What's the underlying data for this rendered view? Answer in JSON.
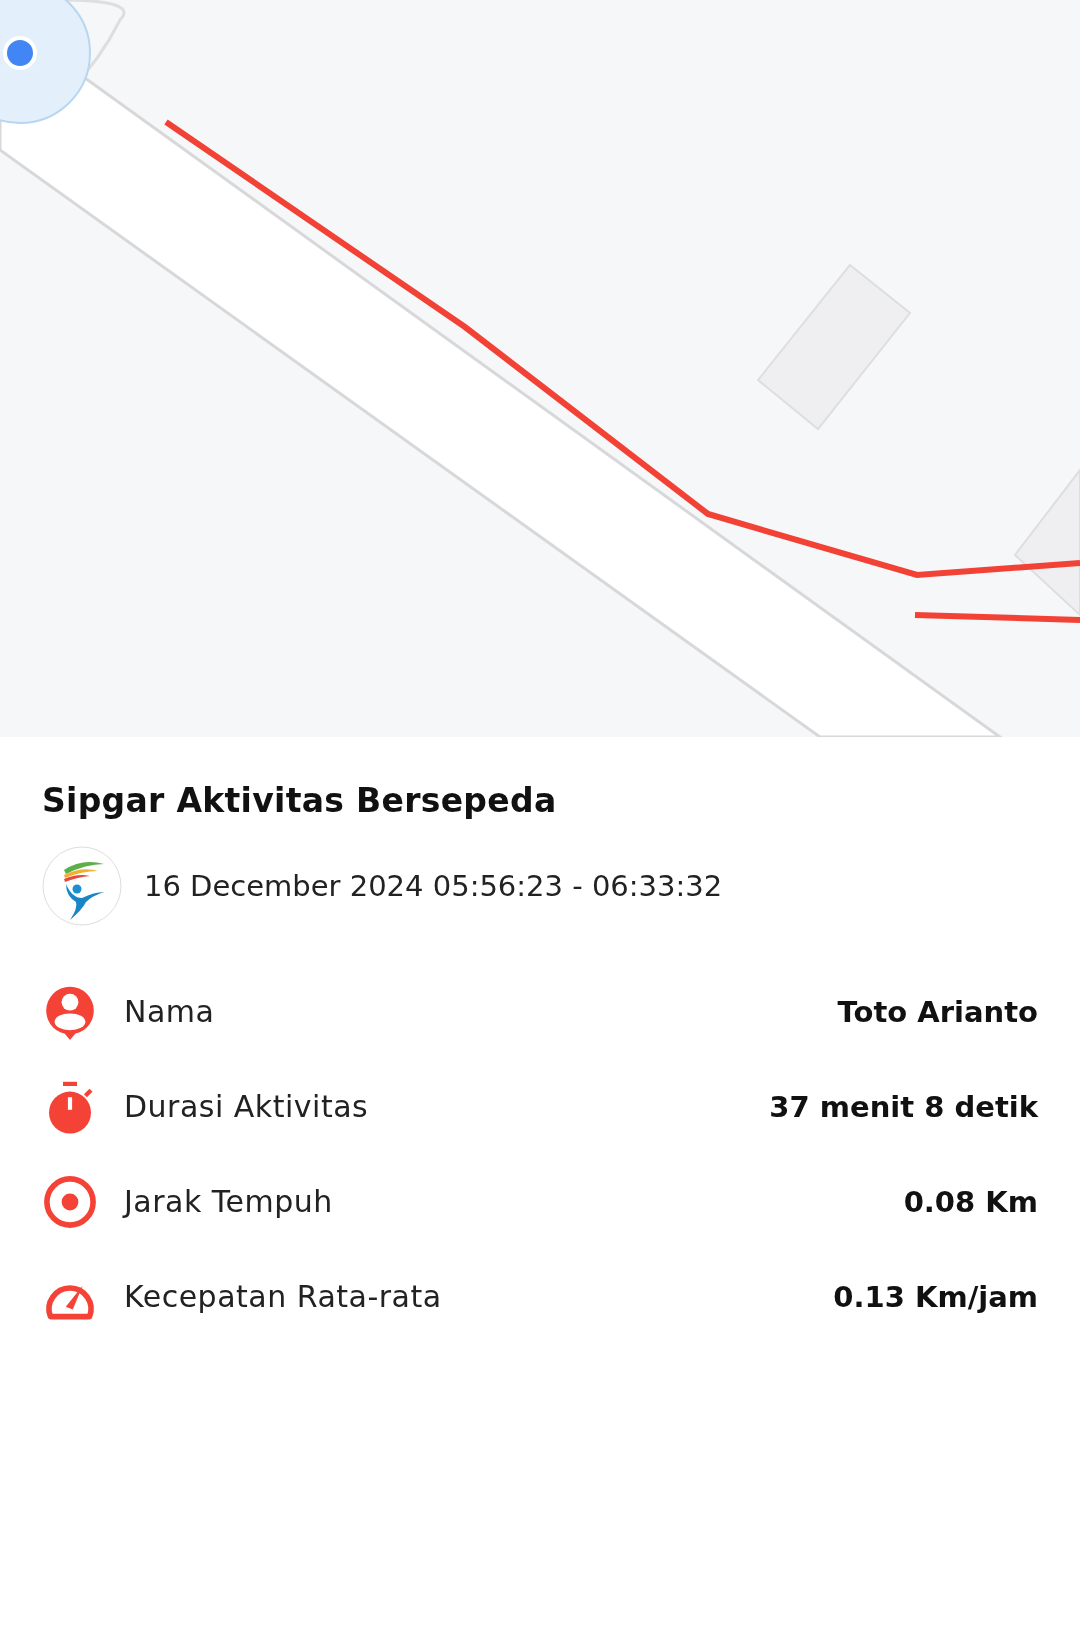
{
  "title": "Sipgar Aktivitas Bersepeda",
  "date_range": "16 December 2024 05:56:23 - 06:33:32",
  "stats": [
    {
      "kind": "person",
      "label": "Nama",
      "value": "Toto Arianto"
    },
    {
      "kind": "timer",
      "label": "Durasi Aktivitas",
      "value": "37 menit 8 detik"
    },
    {
      "kind": "target",
      "label": "Jarak Tempuh",
      "value": "0.08 Km"
    },
    {
      "kind": "gauge",
      "label": "Kecepatan Rata-rata",
      "value": "0.13 Km/jam"
    }
  ]
}
